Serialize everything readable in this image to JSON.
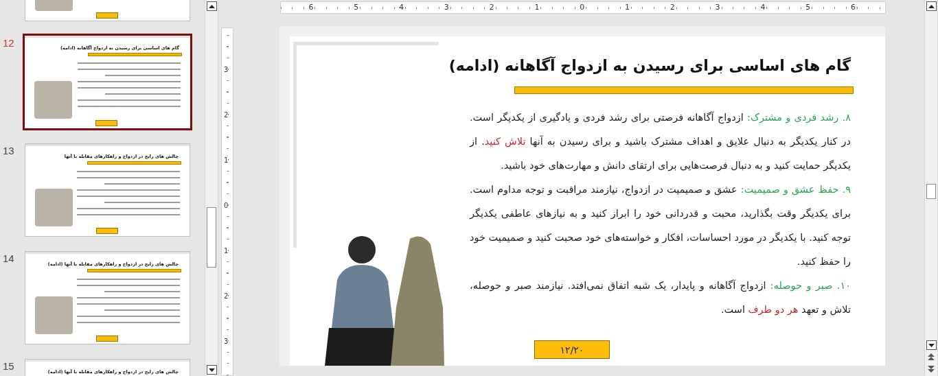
{
  "thumbnails": [
    {
      "selected": false
    },
    {
      "number": "12",
      "title": "گام های اساسی برای رسیدن به ازدواج آگاهانه (ادامه)",
      "selected": true
    },
    {
      "number": "13",
      "title": "چالش های رایج در ازدواج و راهکارهای مقابله با آنها",
      "selected": false
    },
    {
      "number": "14",
      "title": "چالش های رایج در ازدواج و راهکارهای مقابله با آنها (ادامه)",
      "selected": false
    },
    {
      "number": "15",
      "title": "چالش های رایج در ازدواج و راهکارهای مقابله با آنها (ادامه)",
      "selected": false
    }
  ],
  "horizontal_ruler": {
    "labels": [
      "6",
      "5",
      "4",
      "3",
      "2",
      "1",
      "0",
      "1",
      "2",
      "3",
      "4",
      "5",
      "6"
    ]
  },
  "vertical_ruler": {
    "labels": [
      "3",
      "2",
      "1",
      "0",
      "1",
      "2",
      "3"
    ]
  },
  "slide": {
    "title": "گام های اساسی برای رسیدن به ازدواج آگاهانه (ادامه)",
    "paragraphs": [
      [
        {
          "kind": "label",
          "text": "۸. رشد فردی و مشترک:"
        },
        {
          "kind": "text",
          "text": " ازدواج آگاهانه فرصتی برای رشد فردی و یادگیری از یکدیگر است. در کنار یکدیگر به دنبال علایق و اهداف مشترک باشید و برای رسیدن به آنها "
        },
        {
          "kind": "highlight",
          "text": "تلاش کنید"
        },
        {
          "kind": "text",
          "text": ". از یکدیگر حمایت کنید و به دنبال فرصت‌هایی برای ارتقای دانش و مهارت‌های خود باشید."
        }
      ],
      [
        {
          "kind": "label",
          "text": "۹. حفظ عشق و صمیمیت:"
        },
        {
          "kind": "text",
          "text": " عشق و صمیمیت در ازدواج، نیازمند مراقبت و توجه مداوم است. برای یکدیگر وقت بگذارید، محبت و قدردانی خود را ابراز کنید و به نیازهای عاطفی یکدیگر توجه کنید. با یکدیگر در مورد احساسات، افکار و خواسته‌های خود صحبت کنید و صمیمیت خود را حفظ کنید."
        }
      ],
      [
        {
          "kind": "label",
          "text": "۱۰. صبر و حوصله:"
        },
        {
          "kind": "text",
          "text": " ازدواج آگاهانه و پایدار، یک شبه اتفاق نمی‌افتد. نیازمند صبر و حوصله، تلاش و تعهد "
        },
        {
          "kind": "highlight",
          "text": "هر دو طرف"
        },
        {
          "kind": "text",
          "text": " است."
        }
      ]
    ],
    "page_number": "۱۲/۲۰"
  }
}
